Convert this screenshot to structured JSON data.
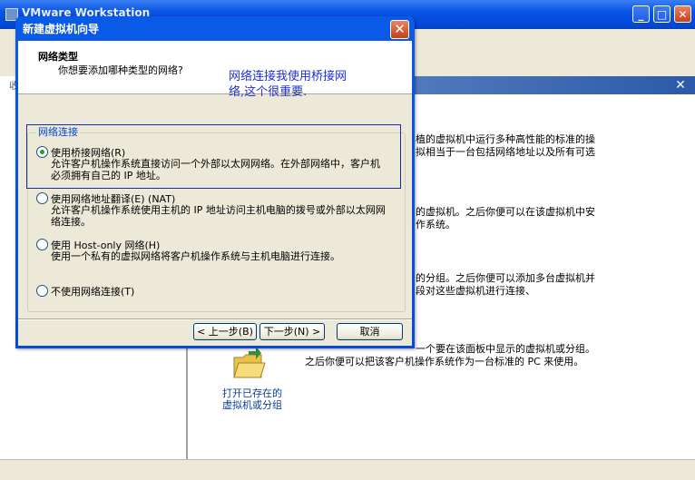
{
  "background_app": {
    "title": "VMware Workstation",
    "left_pane_partial": "收",
    "panel_texts": [
      "植的虚拟机中运行多种高性能的标准的操",
      "拟相当于一台包括网络地址以及所有可选",
      "的虚拟机。之后你便可以在该虚拟机中安",
      "作系统。",
      "的分组。之后你便可以添加多台虚拟机并",
      "段对这些虚拟机进行连接、"
    ],
    "open_existing_desc_1": "一个要在该面板中显示的虚拟机或分组。",
    "open_existing_desc_2": "之后你便可以把该客户机操作系统作为一台标准的 PC 来使用。",
    "open_existing_label_1": "打开已存在的",
    "open_existing_label_2": "虚拟机或分组"
  },
  "dialog": {
    "title": "新建虚拟机向导",
    "header_title": "网络类型",
    "header_subtitle": "你想要添加哪种类型的网络?",
    "annotation": "网络连接我使用桥接网\n络,这个很重要.",
    "group_label": "网络连接",
    "options": [
      {
        "label": "使用桥接网络(R)",
        "desc": "允许客户机操作系统直接访问一个外部以太网网络。在外部网络中，客户机必须拥有自己的 IP 地址。",
        "selected": true
      },
      {
        "label": "使用网络地址翻译(E) (NAT)",
        "desc": "允许客户机操作系统使用主机的 IP 地址访问主机电脑的拨号或外部以太网网络连接。",
        "selected": false
      },
      {
        "label": "使用 Host-only 网络(H)",
        "desc": "使用一个私有的虚拟网络将客户机操作系统与主机电脑进行连接。",
        "selected": false
      },
      {
        "label": "不使用网络连接(T)",
        "desc": "",
        "selected": false
      }
    ],
    "buttons": {
      "back": "< 上一步(B)",
      "next": "下一步(N) >",
      "cancel": "取消"
    }
  },
  "colors": {
    "titlebar": "#0a54e3",
    "annotation": "#1f2fd0",
    "legend": "#0046d5",
    "highlight_box": "#1b2aa8"
  },
  "icons": [
    "close-icon",
    "minimize-icon",
    "maximize-icon",
    "folder-icon"
  ]
}
